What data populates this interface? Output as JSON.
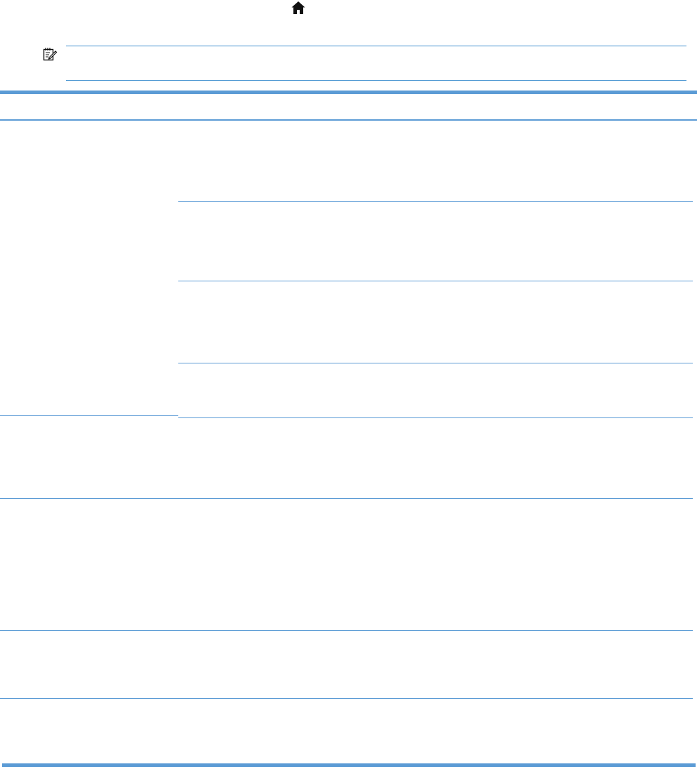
{
  "page": {
    "icons": {
      "home": "home-icon",
      "note": "note-icon"
    },
    "colors": {
      "rule": "#5b9bd5",
      "icon": "#111111"
    }
  },
  "table": {
    "columns": [
      "",
      "",
      ""
    ],
    "rows": [
      {
        "group": 1,
        "cells": [
          "",
          "",
          ""
        ]
      },
      {
        "group": 1,
        "cells": [
          "",
          "",
          ""
        ]
      },
      {
        "group": 1,
        "cells": [
          "",
          "",
          ""
        ]
      },
      {
        "group": 1,
        "cells": [
          "",
          "",
          ""
        ]
      },
      {
        "group": 2,
        "cells": [
          "",
          "",
          ""
        ]
      },
      {
        "group": 3,
        "cells": [
          "",
          "",
          ""
        ]
      },
      {
        "group": 4,
        "cells": [
          "",
          "",
          ""
        ]
      },
      {
        "group": 5,
        "cells": [
          "",
          "",
          ""
        ]
      }
    ]
  }
}
